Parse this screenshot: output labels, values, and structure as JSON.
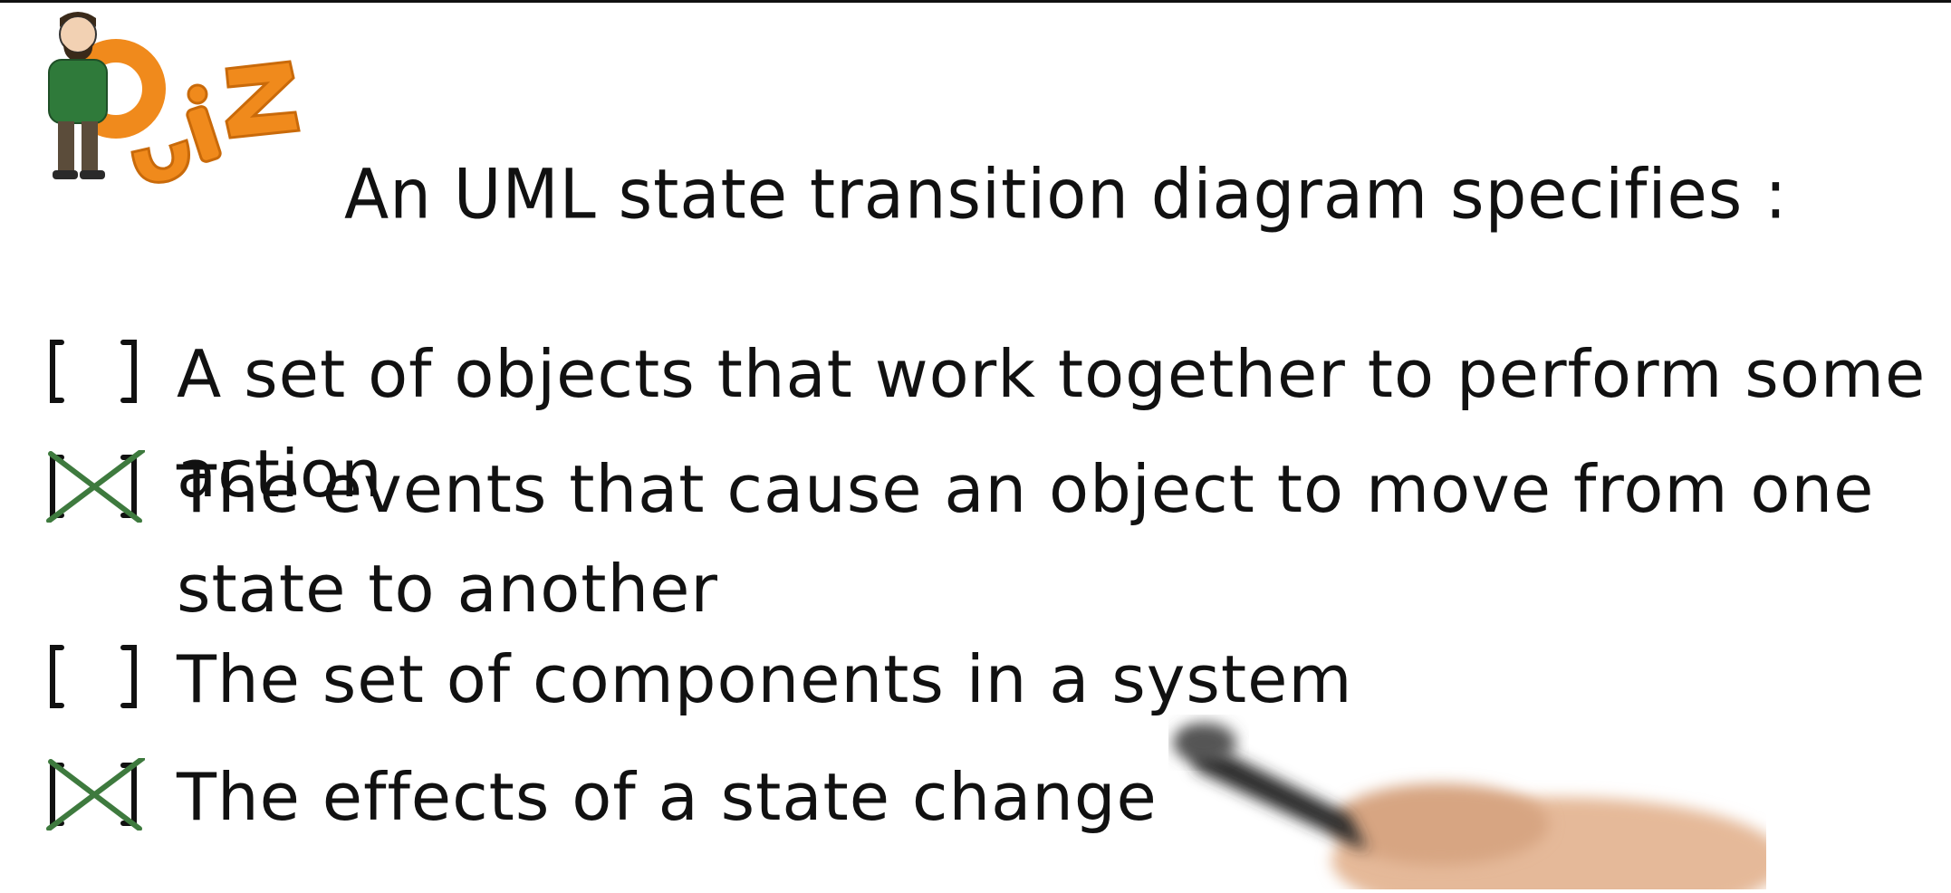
{
  "logo": {
    "text": "QUIZ",
    "icon": "character-holding-q-icon",
    "color": "#f08a1c"
  },
  "question": {
    "text": "An UML state transition diagram specifies :"
  },
  "options": [
    {
      "text": "A set of objects that work together to perform some action",
      "checked": false,
      "box_closed": "[ ]"
    },
    {
      "text": "The events that cause an object to move from one state to another",
      "checked": true,
      "box_closed": "[X]"
    },
    {
      "text": "The set of components in a system",
      "checked": false,
      "box_closed": "[ ]"
    },
    {
      "text": "The effects of a state change",
      "checked": true,
      "box_closed": "[X]"
    }
  ],
  "colors": {
    "ink": "#111111",
    "checkmark": "#3e7a3e",
    "logo_orange": "#f08a1c"
  }
}
